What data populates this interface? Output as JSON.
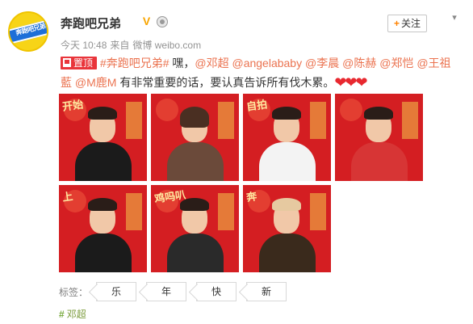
{
  "header": {
    "avatar_logo_text": "奔跑吧兄弟",
    "account_name": "奔跑吧兄弟",
    "verified_icon": "verified-v-icon",
    "time": "今天 10:48",
    "source_prefix": "来自",
    "source": "微博 weibo.com",
    "follow_label": "关注"
  },
  "post": {
    "pin_badge": "置顶",
    "topic": "#奔跑吧兄弟#",
    "text_1": " 嘿，",
    "mentions": [
      "@邓超",
      "@angelababy",
      "@李晨",
      "@陈赫",
      "@郑恺",
      "@王祖藍",
      "@M鹿M"
    ],
    "text_2": " 有非常重要的话，要认真告诉所有伐木累。",
    "hearts": "❤❤❤"
  },
  "photos": [
    {
      "caption": "开始"
    },
    {
      "caption": ""
    },
    {
      "caption": "自拍"
    },
    {
      "caption": ""
    },
    {
      "caption": "上"
    },
    {
      "caption": "鸡吗叭"
    },
    {
      "caption": "奔"
    }
  ],
  "tags": {
    "label": "标签：",
    "items": [
      "乐",
      "年",
      "快",
      "新"
    ]
  },
  "footer": {
    "topic_tag": "邓超"
  },
  "colors": {
    "accent_orange": "#eb7350",
    "badge_red": "#e9353b",
    "photo_red": "#d41e22",
    "tag_green": "#7a9a3a"
  }
}
